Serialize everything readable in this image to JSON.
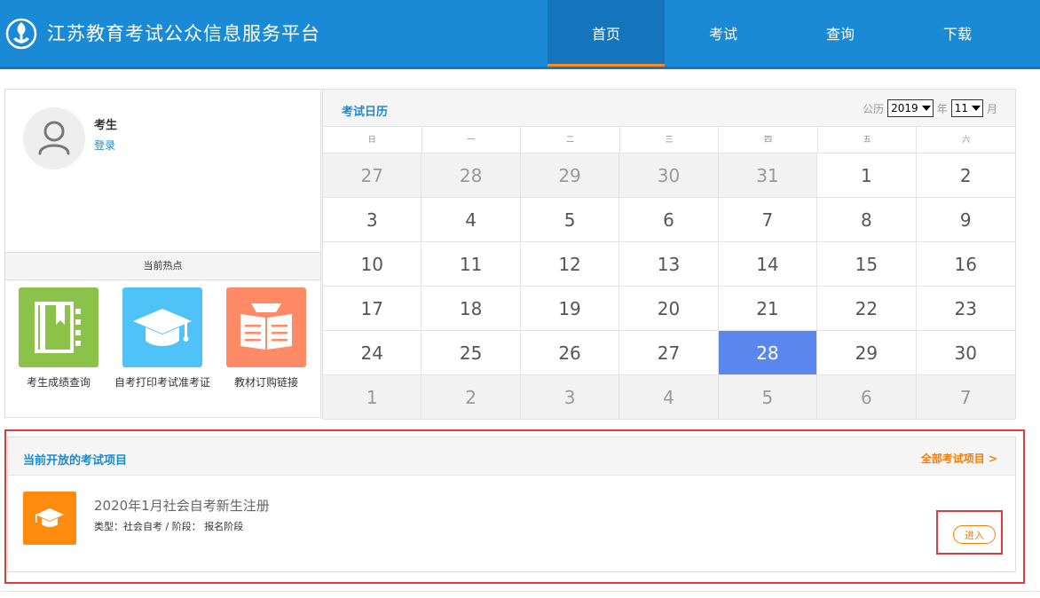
{
  "header": {
    "title": "江苏教育考试公众信息服务平台",
    "nav": [
      {
        "label": "首页",
        "active": true
      },
      {
        "label": "考试",
        "active": false
      },
      {
        "label": "查询",
        "active": false
      },
      {
        "label": "下载",
        "active": false
      }
    ]
  },
  "user": {
    "name": "考生",
    "login": "登录"
  },
  "hot": {
    "title": "当前热点",
    "items": [
      {
        "label": "考生成绩查询",
        "icon": "notebook-icon",
        "color": "#8bc34a"
      },
      {
        "label": "自考打印考试准考证",
        "icon": "graduation-cap-icon",
        "color": "#4fc3f7"
      },
      {
        "label": "教材订购链接",
        "icon": "open-book-icon",
        "color": "#ff8a65"
      }
    ]
  },
  "calendar": {
    "title": "考试日历",
    "calendar_label": "公历",
    "year": "2019",
    "year_label": "年",
    "month": "11",
    "month_label": "月",
    "weekdays": [
      "日",
      "一",
      "二",
      "三",
      "四",
      "五",
      "六"
    ],
    "days": [
      {
        "d": "27",
        "other": true
      },
      {
        "d": "28",
        "other": true
      },
      {
        "d": "29",
        "other": true
      },
      {
        "d": "30",
        "other": true
      },
      {
        "d": "31",
        "other": true
      },
      {
        "d": "1"
      },
      {
        "d": "2"
      },
      {
        "d": "3"
      },
      {
        "d": "4"
      },
      {
        "d": "5"
      },
      {
        "d": "6"
      },
      {
        "d": "7"
      },
      {
        "d": "8"
      },
      {
        "d": "9"
      },
      {
        "d": "10"
      },
      {
        "d": "11"
      },
      {
        "d": "12"
      },
      {
        "d": "13"
      },
      {
        "d": "14"
      },
      {
        "d": "15"
      },
      {
        "d": "16"
      },
      {
        "d": "17"
      },
      {
        "d": "18"
      },
      {
        "d": "19"
      },
      {
        "d": "20"
      },
      {
        "d": "21"
      },
      {
        "d": "22"
      },
      {
        "d": "23"
      },
      {
        "d": "24"
      },
      {
        "d": "25"
      },
      {
        "d": "26"
      },
      {
        "d": "27"
      },
      {
        "d": "28",
        "today": true
      },
      {
        "d": "29"
      },
      {
        "d": "30"
      },
      {
        "d": "1",
        "other": true
      },
      {
        "d": "2",
        "other": true
      },
      {
        "d": "3",
        "other": true
      },
      {
        "d": "4",
        "other": true
      },
      {
        "d": "5",
        "other": true
      },
      {
        "d": "6",
        "other": true
      },
      {
        "d": "7",
        "other": true
      }
    ],
    "today_color": "#5b86ee"
  },
  "exams": {
    "title": "当前开放的考试项目",
    "all_link": "全部考试项目 >",
    "item": {
      "name": "2020年1月社会自考新生注册",
      "meta": "类型：社会自考 / 阶段： 报名阶段",
      "enter": "进入",
      "icon": "graduation-cap-icon",
      "icon_color": "#ff8c0f"
    }
  },
  "colors": {
    "header": "#1a8ad6",
    "accent": "#ff7a00",
    "highlight": "#e8383a"
  }
}
